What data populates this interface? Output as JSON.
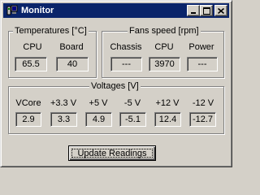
{
  "window": {
    "title": "Monitor",
    "controls": {
      "minimize": "minimize",
      "maximize": "maximize",
      "close": "close"
    }
  },
  "temperatures": {
    "legend": "Temperatures [°C]",
    "items": [
      {
        "label": "CPU",
        "value": "65.5"
      },
      {
        "label": "Board",
        "value": "40"
      }
    ]
  },
  "fans": {
    "legend": "Fans speed [rpm]",
    "items": [
      {
        "label": "Chassis",
        "value": "---"
      },
      {
        "label": "CPU",
        "value": "3970"
      },
      {
        "label": "Power",
        "value": "---"
      }
    ]
  },
  "voltages": {
    "legend": "Voltages [V]",
    "items": [
      {
        "label": "VCore",
        "value": "2.9"
      },
      {
        "label": "+3.3 V",
        "value": "3.3"
      },
      {
        "label": "+5 V",
        "value": "4.9"
      },
      {
        "label": "-5 V",
        "value": "-5.1"
      },
      {
        "label": "+12 V",
        "value": "12.4"
      },
      {
        "label": "-12 V",
        "value": "-12.7"
      }
    ]
  },
  "actions": {
    "update_label": "Update Readings"
  },
  "icons": {
    "app": "monitor-app-icon",
    "minimize": "minimize-icon",
    "maximize": "maximize-icon",
    "close": "close-icon"
  },
  "colors": {
    "titlebar": "#0a246a",
    "face": "#d4d0c8"
  }
}
